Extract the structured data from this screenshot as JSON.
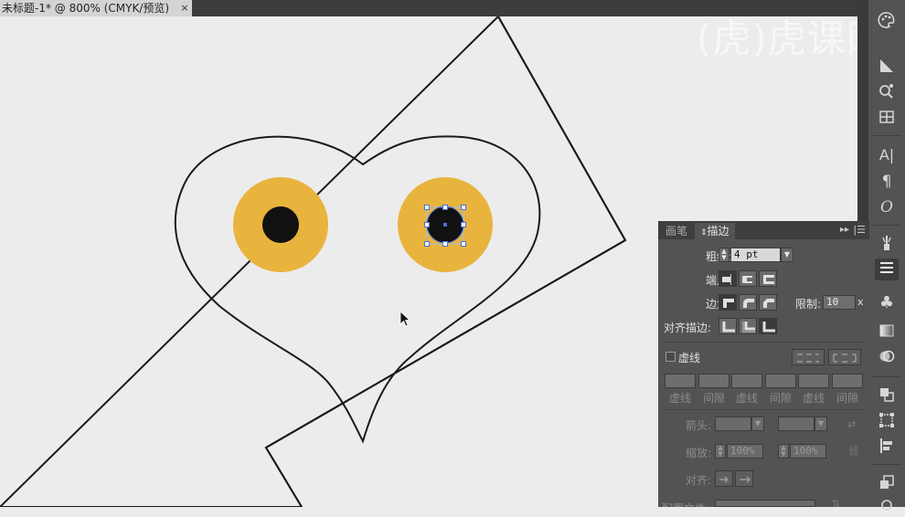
{
  "document": {
    "tab_title": "未标题-1* @ 800% (CMYK/预览)",
    "close_glyph": "×"
  },
  "watermark": {
    "text": "(虎)虎课网"
  },
  "colors": {
    "eye_iris": "#e8b43e",
    "pupil": "#111111",
    "outline": "#1a1a1a",
    "canvas": "#ececec",
    "selection": "#4a6fd8"
  },
  "stroke_panel": {
    "tabs": [
      {
        "label": "画笔",
        "active": false
      },
      {
        "label": "描边",
        "active": true
      }
    ],
    "weight": {
      "label": "粗细:",
      "value": "4 pt"
    },
    "cap_label": "端点:",
    "corner_label": "边角:",
    "limit": {
      "label": "限制:",
      "value": "10",
      "suffix": "x"
    },
    "align_label": "对齐描边:",
    "dashed": {
      "label": "虚线",
      "checked": false
    },
    "dash_labels": [
      "虚线",
      "间隙",
      "虚线",
      "间隙",
      "虚线",
      "间隙"
    ],
    "arrowhead_label": "箭头:",
    "scale": {
      "label": "缩放:",
      "start": "100%",
      "end": "100%"
    },
    "align_arrows_label": "对齐:",
    "profile_label": "配置文件:"
  },
  "right_dock": {
    "tools": [
      "color-palette-icon",
      "gradient-swatch-icon",
      "symbols-icon",
      "grid-icon",
      "character-icon",
      "paragraph-icon",
      "opentype-icon",
      "brush-icon",
      "stroke-icon",
      "club-symbol-icon",
      "gradient-icon",
      "transparency-icon",
      "pathfinder-icon",
      "transform-icon",
      "align-icon",
      "layers-icon",
      "appearance-icon"
    ],
    "glyphs": {
      "character": "A|",
      "paragraph": "¶",
      "opentype": "O",
      "club": "♣"
    }
  }
}
